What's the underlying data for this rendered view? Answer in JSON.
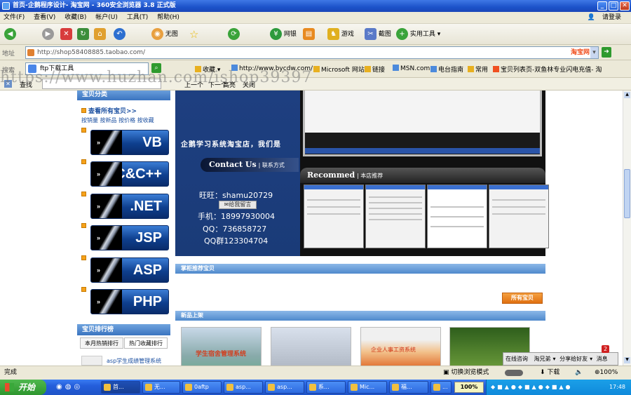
{
  "window": {
    "title": "首页-企鹅程序设计- 淘宝网 - 360安全浏览器 3.8 正式版",
    "minimize": "_",
    "maximize": "□",
    "close": "✕"
  },
  "menu": {
    "items": [
      "文件(F)",
      "查看(V)",
      "收藏(B)",
      "帐户(U)",
      "工具(T)",
      "帮助(H)"
    ],
    "login": "请登录"
  },
  "toolbar": {
    "back_icon": "arrow-left-icon",
    "no_image": "无图",
    "bookmark_star": "☆",
    "wangyin": "网银",
    "games": "游戏",
    "screenshot": "截图",
    "tools": "实用工具"
  },
  "address": {
    "label": "地址",
    "url": "http://shop58408885.taobao.com/",
    "site_badge": "淘宝网"
  },
  "favorites": {
    "search_label": "搜索",
    "search_value": "ftp下载工具",
    "items": [
      "收藏",
      "http://www.bycdw.com/",
      "Microsoft 网站",
      "链接",
      "MSN.com",
      "电台指南",
      "常用",
      "宝贝列表页-双鱼林专业闪电充值- 淘"
    ]
  },
  "findbar": {
    "find": "查找",
    "next": "上一个",
    "prev": "下一个",
    "highlight": "高亮",
    "close": "关闭"
  },
  "watermark": "https://www.huzhan.com/ishop39397",
  "shop": {
    "category_header": "宝贝分类",
    "view_all": "查看所有宝贝>>",
    "sort_links": [
      "按销量",
      "按新品",
      "按价格",
      "按收藏"
    ],
    "categories": [
      "VB",
      "C&C++",
      ".NET",
      "JSP",
      "ASP",
      "PHP"
    ],
    "ranking_header": "宝贝排行榜",
    "ranking_tabs": [
      "本月热销排行",
      "热门收藏排行"
    ],
    "ranking_item": "asp学生成绩管理系统",
    "banner_slogan": "企鹅学习系统淘宝店，我们是",
    "contact_title": "Contact Us",
    "contact_subtitle": "联系方式",
    "wangwang": "旺旺：shamu20729",
    "message_button": "给我留言",
    "phone": "手机：18997930004",
    "qq": "QQ：736858727",
    "qq_group": "QQ群123304704",
    "recommend_title": "Recommed",
    "recommend_subtitle": "本店推荐",
    "featured_section": "掌柜推荐宝贝",
    "all_items_button": "所有宝贝",
    "new_section": "新品上架",
    "new_item_caption": "学生宿舍管理系统",
    "new_item_caption2": "企业人事工资系统"
  },
  "popup": {
    "items": [
      "在线咨询",
      "淘兄弟",
      "分享给好友",
      "消息"
    ],
    "badge": "2"
  },
  "status": {
    "text": "完成",
    "mode": "切换浏览模式",
    "download": "下载",
    "zoom": "100%"
  },
  "taskbar": {
    "start": "开始",
    "tasks": [
      "首...",
      "无...",
      "0aftp",
      "asp...",
      "asp...",
      "系...",
      "Mic...",
      "福...",
      "..."
    ],
    "zoom_badge": "100%",
    "clock": "17:48"
  },
  "colors": {
    "title_blue": "#1c52c9",
    "button_orange": "#f08a24",
    "section_blue": "#4f89cc"
  }
}
